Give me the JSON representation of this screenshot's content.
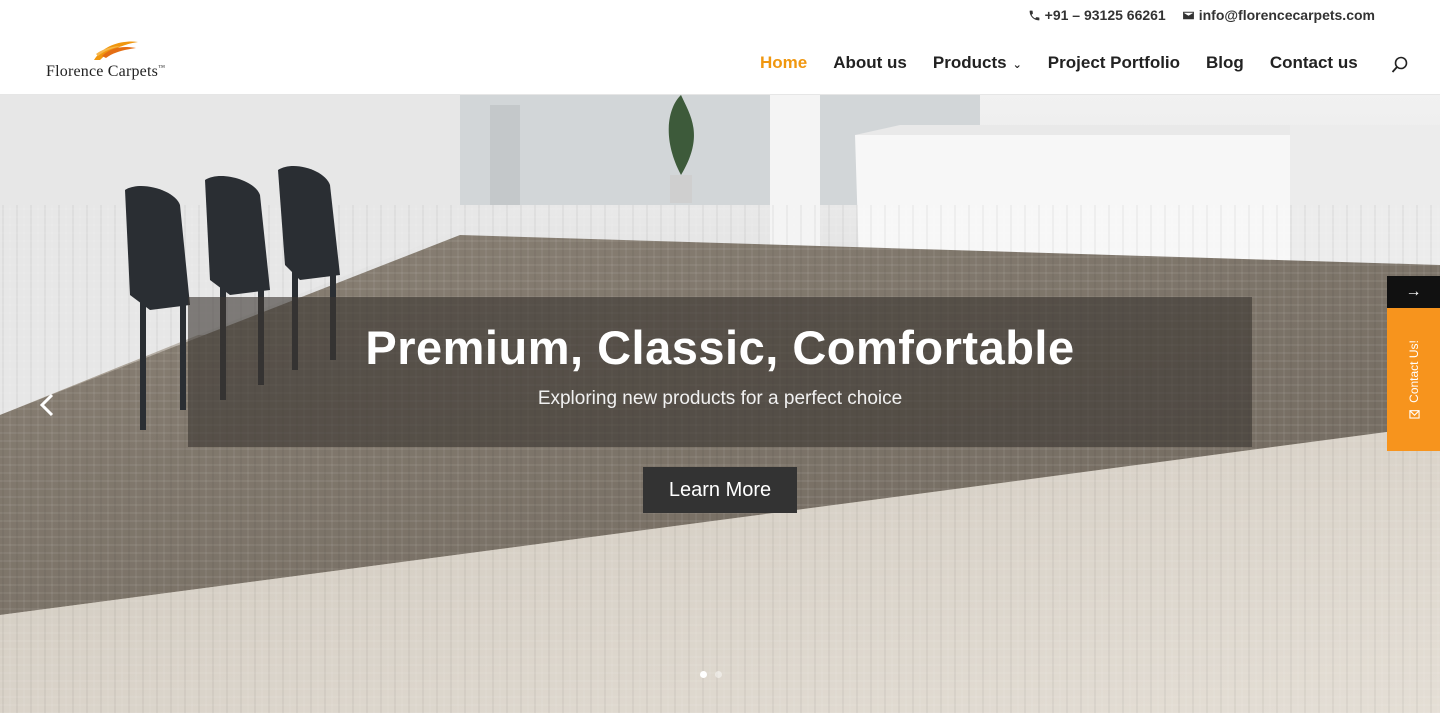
{
  "header": {
    "phone": "+91 – 93125 66261",
    "email": "info@florencecarpets.com",
    "logo_text": "Florence Carpets",
    "logo_tm": "™"
  },
  "nav": {
    "items": [
      {
        "label": "Home",
        "active": true
      },
      {
        "label": "About us"
      },
      {
        "label": "Products",
        "has_dropdown": true
      },
      {
        "label": "Project Portfolio"
      },
      {
        "label": "Blog"
      },
      {
        "label": "Contact us"
      }
    ]
  },
  "hero": {
    "title": "Premium, Classic, Comfortable",
    "subtitle": "Exploring new products for a perfect choice",
    "button_label": "Learn More",
    "slide_count": 2,
    "active_slide": 1
  },
  "side_tab": {
    "arrow": "→",
    "label": "Contact Us!"
  },
  "colors": {
    "accent": "#f0970f",
    "side_tab": "#f7941d",
    "button": "#333333"
  },
  "icons": [
    "phone-icon",
    "mail-icon",
    "search-icon",
    "chevron-down-icon",
    "chevron-left-icon",
    "envelope-icon"
  ]
}
